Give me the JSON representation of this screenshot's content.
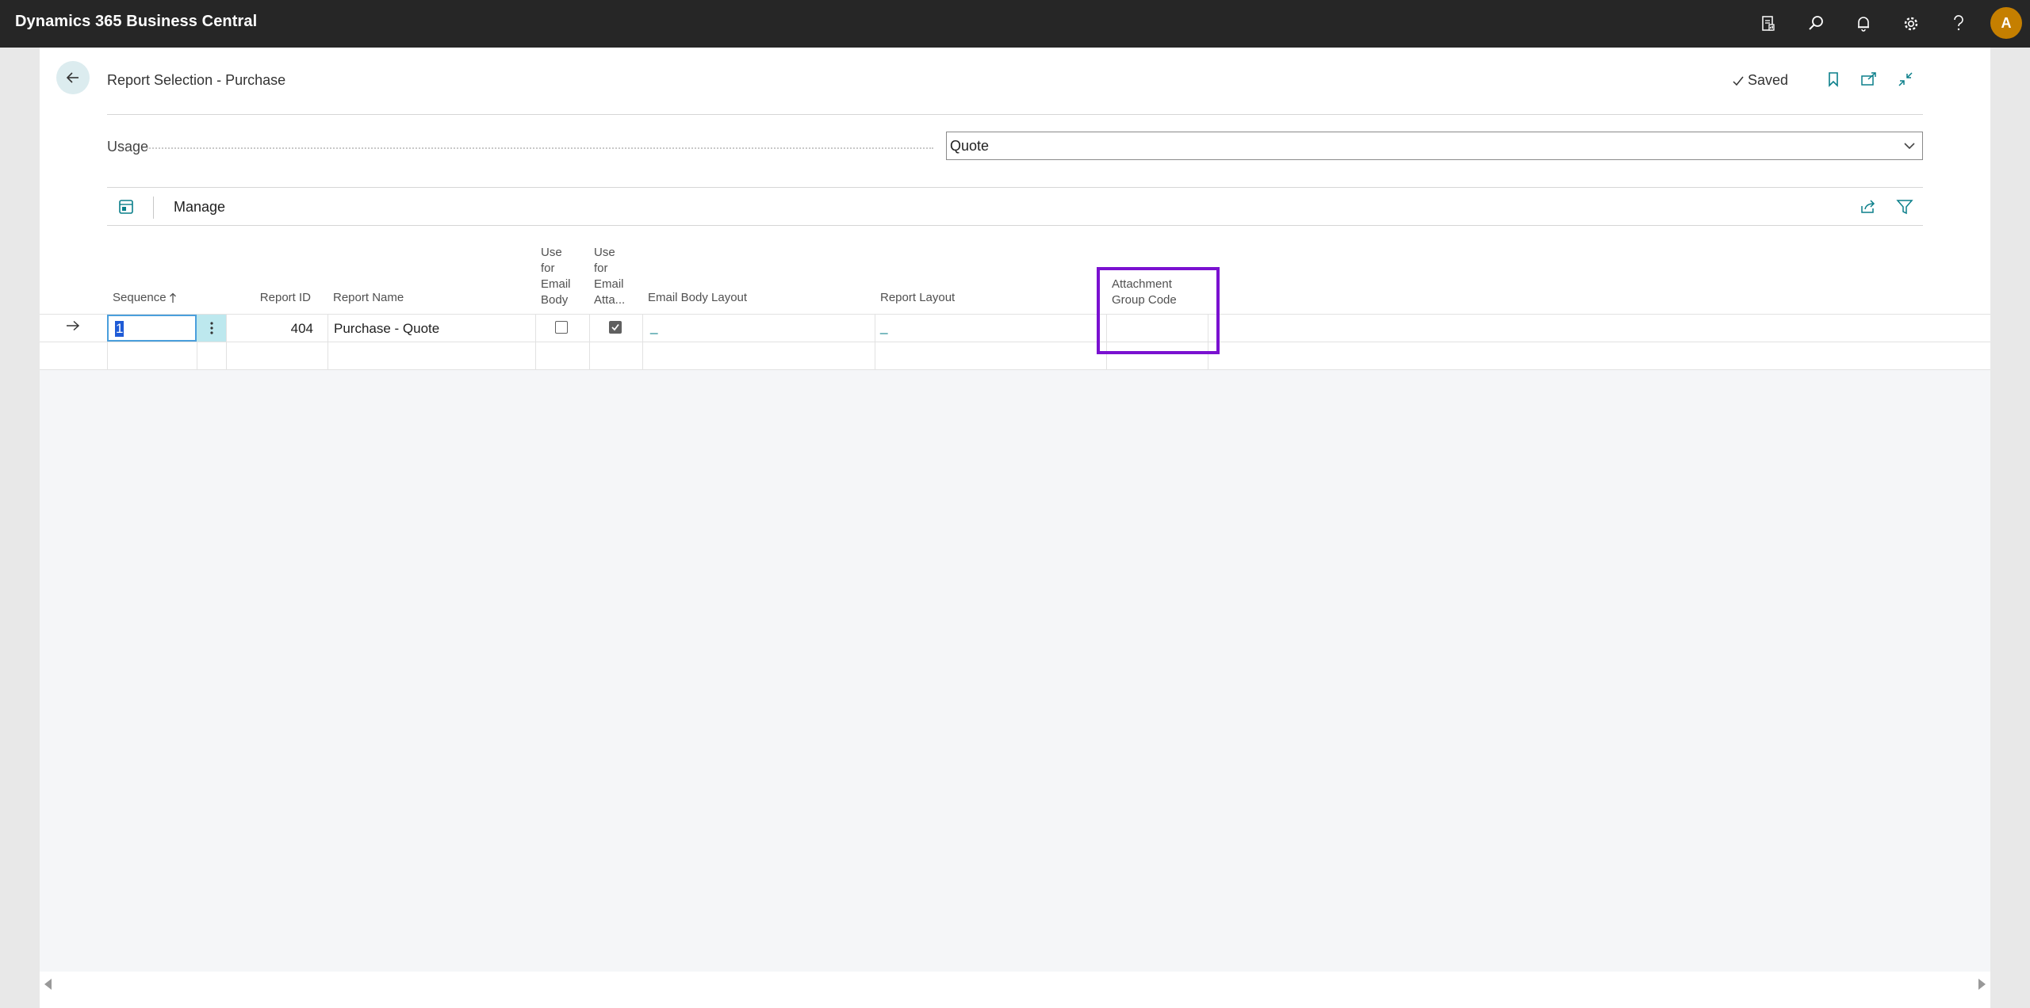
{
  "app": {
    "title": "Dynamics 365 Business Central",
    "avatar_initial": "A",
    "accent": "#0a7f8a",
    "topbar_icons": [
      "report-icon",
      "search-icon",
      "bell-icon",
      "gear-icon",
      "help-icon"
    ]
  },
  "page": {
    "title": "Report Selection - Purchase",
    "saved_label": "Saved"
  },
  "usage": {
    "label": "Usage",
    "value": "Quote"
  },
  "toolbar": {
    "manage_label": "Manage"
  },
  "grid": {
    "headers": {
      "sequence": "Sequence",
      "report_id": "Report ID",
      "report_name": "Report Name",
      "use_email_body": [
        "Use",
        "for",
        "Email",
        "Body"
      ],
      "use_email_attachment": [
        "Use",
        "for",
        "Email",
        "Atta..."
      ],
      "email_body_layout": "Email Body Layout",
      "report_layout": "Report Layout",
      "attachment_group_code": [
        "Attachment",
        "Group Code"
      ]
    },
    "rows": [
      {
        "sequence": "1",
        "report_id": "404",
        "report_name": "Purchase - Quote",
        "use_email_body": false,
        "use_email_attachment": true,
        "email_body_layout": "_",
        "report_layout": "_",
        "attachment_group_code": ""
      }
    ]
  },
  "highlight_color": "#7a11d0"
}
